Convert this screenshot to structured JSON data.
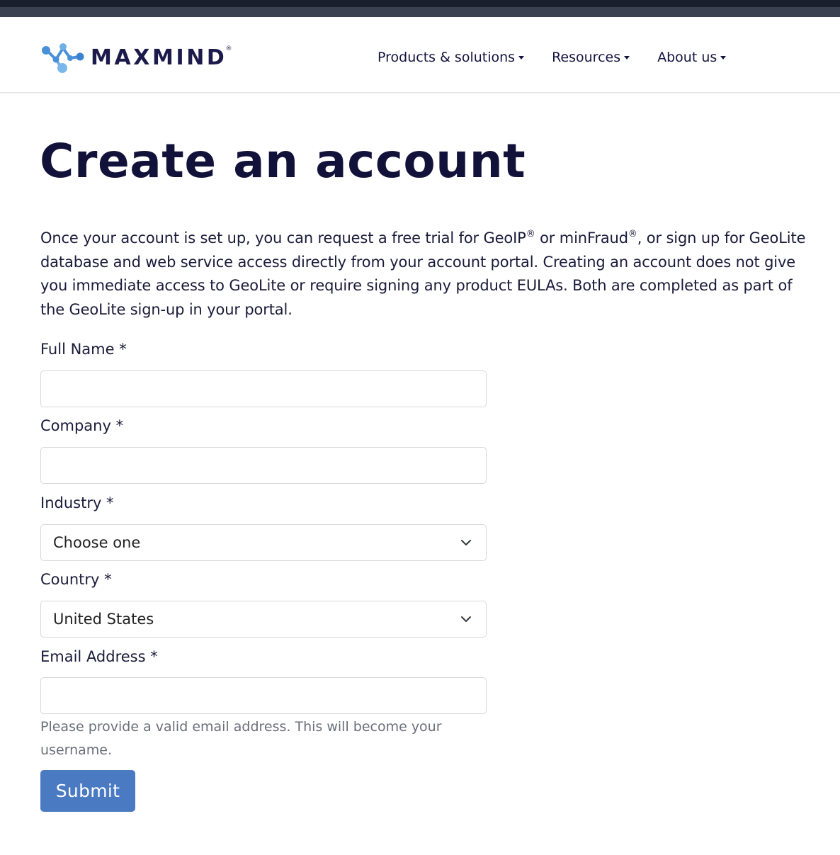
{
  "brand": {
    "name": "MAXMIND",
    "registered_mark": "®",
    "colors": {
      "navy": "#1c1a4a",
      "logo_blue": "#4a90d9",
      "button": "#4a7bc2"
    }
  },
  "nav": {
    "items": [
      {
        "label": "Products & solutions"
      },
      {
        "label": "Resources"
      },
      {
        "label": "About us"
      }
    ]
  },
  "page": {
    "title": "Create an account",
    "intro": {
      "part1": "Once your account is set up, you can request a free trial for GeoIP",
      "reg1": "®",
      "part2": " or minFraud",
      "reg2": "®",
      "part3": ", or sign up for GeoLite database and web service access directly from your account portal. Creating an account does not give you immediate access to GeoLite or require signing any product EULAs. Both are completed as part of the GeoLite sign-up in your portal."
    }
  },
  "form": {
    "full_name": {
      "label": "Full Name *",
      "value": ""
    },
    "company": {
      "label": "Company *",
      "value": ""
    },
    "industry": {
      "label": "Industry *",
      "selected": "Choose one"
    },
    "country": {
      "label": "Country *",
      "selected": "United States"
    },
    "email": {
      "label": "Email Address *",
      "value": "",
      "help": "Please provide a valid email address. This will become your username."
    },
    "submit_label": "Submit"
  }
}
